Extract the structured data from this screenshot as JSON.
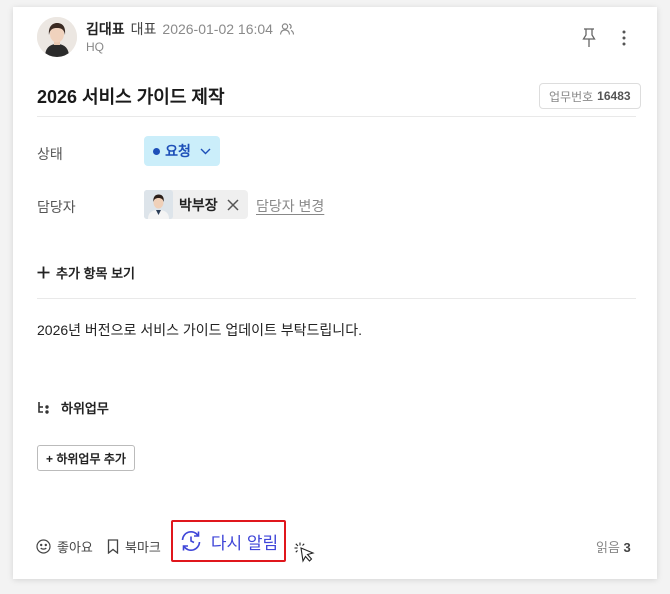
{
  "author": {
    "name": "김대표",
    "role": "대표",
    "datetime": "2026-01-02 16:04",
    "org": "HQ"
  },
  "task": {
    "title": "2026 서비스 가이드 제작",
    "number_label": "업무번호",
    "number": "16483"
  },
  "fields": {
    "status_label": "상태",
    "status_value": "요청",
    "assignee_label": "담당자",
    "assignee_name": "박부장",
    "change_assignee": "담당자 변경"
  },
  "more_items": "추가 항목 보기",
  "description": "2026년 버전으로 서비스 가이드 업데이트 부탁드립니다.",
  "subtasks": {
    "heading": "하위업무",
    "add_button": "+ 하위업무 추가"
  },
  "footer": {
    "like": "좋아요",
    "bookmark": "북마크",
    "remind": "다시 알림",
    "reads_label": "읽음",
    "reads_count": "3"
  },
  "icons": [
    "team-icon",
    "pin-icon",
    "more-vertical-icon",
    "chevron-down-icon",
    "close-icon",
    "plus-icon",
    "subtask-icon",
    "smile-icon",
    "bookmark-icon",
    "refresh-clock-icon",
    "cursor-click-icon"
  ],
  "colors": {
    "status_bg": "#cbeefa",
    "status_text": "#1d4fb8",
    "remind_text": "#3f46d8",
    "highlight_border": "#e0161c"
  }
}
